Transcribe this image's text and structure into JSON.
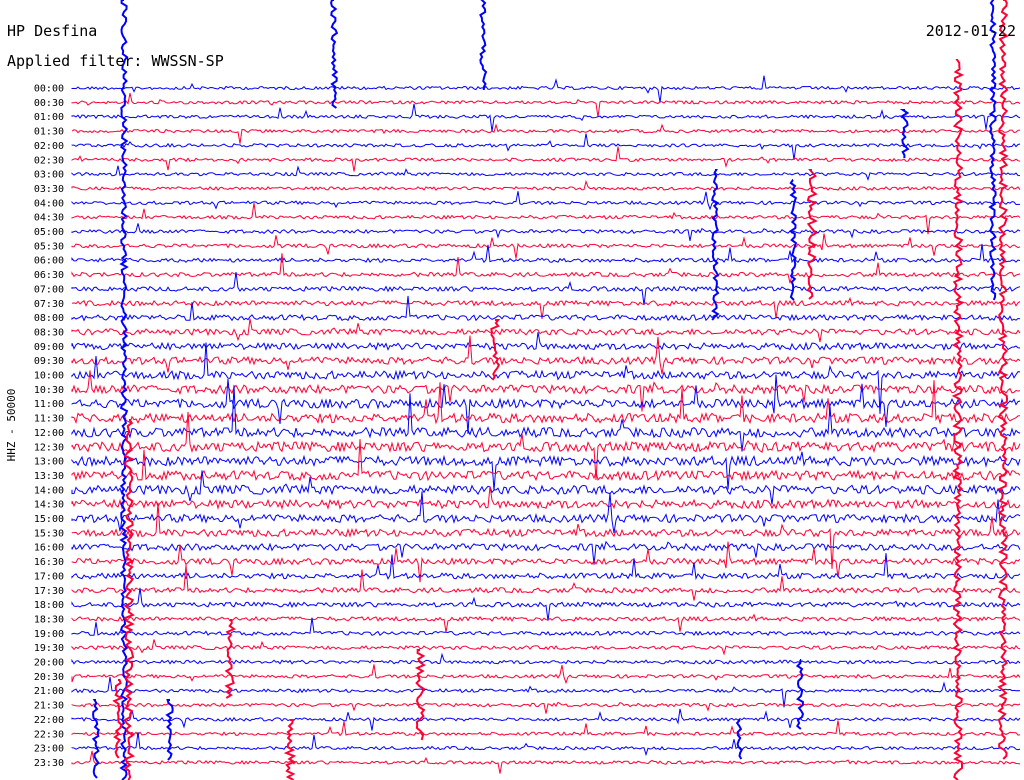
{
  "chart_data": {
    "type": "line",
    "title": "HP Desfina",
    "subtitle": "Applied filter: WWSSN-SP",
    "date": "2012-01-22",
    "ylabel": "HHZ - 50000",
    "tick_labels": [
      "00:00",
      "00:30",
      "01:00",
      "01:30",
      "02:00",
      "02:30",
      "03:00",
      "03:30",
      "04:00",
      "04:30",
      "05:00",
      "05:30",
      "06:00",
      "06:30",
      "07:00",
      "07:30",
      "08:00",
      "08:30",
      "09:00",
      "09:30",
      "10:00",
      "10:30",
      "11:00",
      "11:30",
      "12:00",
      "12:30",
      "13:00",
      "13:30",
      "14:00",
      "14:30",
      "15:00",
      "15:30",
      "16:00",
      "16:30",
      "17:00",
      "17:30",
      "18:00",
      "18:30",
      "19:00",
      "19:30",
      "20:00",
      "20:30",
      "21:00",
      "21:30",
      "22:00",
      "22:30",
      "23:00",
      "23:30"
    ],
    "series_colors": [
      "#0000ff",
      "#ff0033"
    ],
    "grid": false
  }
}
